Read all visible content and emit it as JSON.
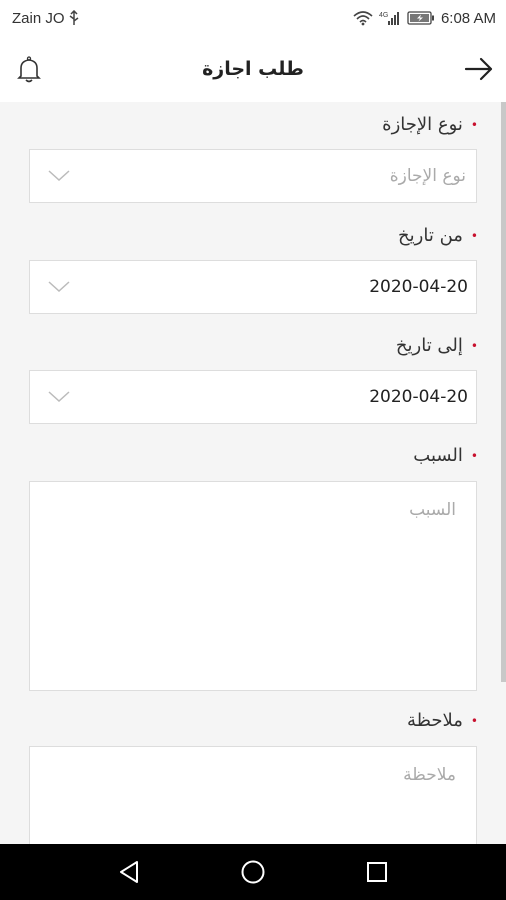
{
  "status_bar": {
    "carrier": "Zain JO",
    "usb_icon": "usb-icon",
    "wifi_icon": "wifi-icon",
    "signal_icon": "signal-icon",
    "battery_icon": "battery-charging-icon",
    "time": "6:08 AM"
  },
  "app_bar": {
    "title": "طلب اجازة",
    "bell_icon": "bell-icon",
    "back_icon": "arrow-right-icon"
  },
  "form": {
    "leave_type": {
      "label": "نوع الإجازة",
      "placeholder": "نوع الإجازة",
      "required": "•"
    },
    "from_date": {
      "label": "من تاريخ",
      "value": "2020-04-20",
      "required": "•"
    },
    "to_date": {
      "label": "إلى تاريخ",
      "value": "2020-04-20",
      "required": "•"
    },
    "reason": {
      "label": "السبب",
      "placeholder": "السبب",
      "required": "•"
    },
    "note": {
      "label": "ملاحظة",
      "placeholder": "ملاحظة",
      "required": "•"
    }
  },
  "nav_bar": {
    "back_icon": "triangle-back-icon",
    "home_icon": "circle-home-icon",
    "recents_icon": "square-recents-icon"
  },
  "colors": {
    "accent_required": "#c8102e",
    "background": "#f5f5f5",
    "navbar": "#000000"
  }
}
